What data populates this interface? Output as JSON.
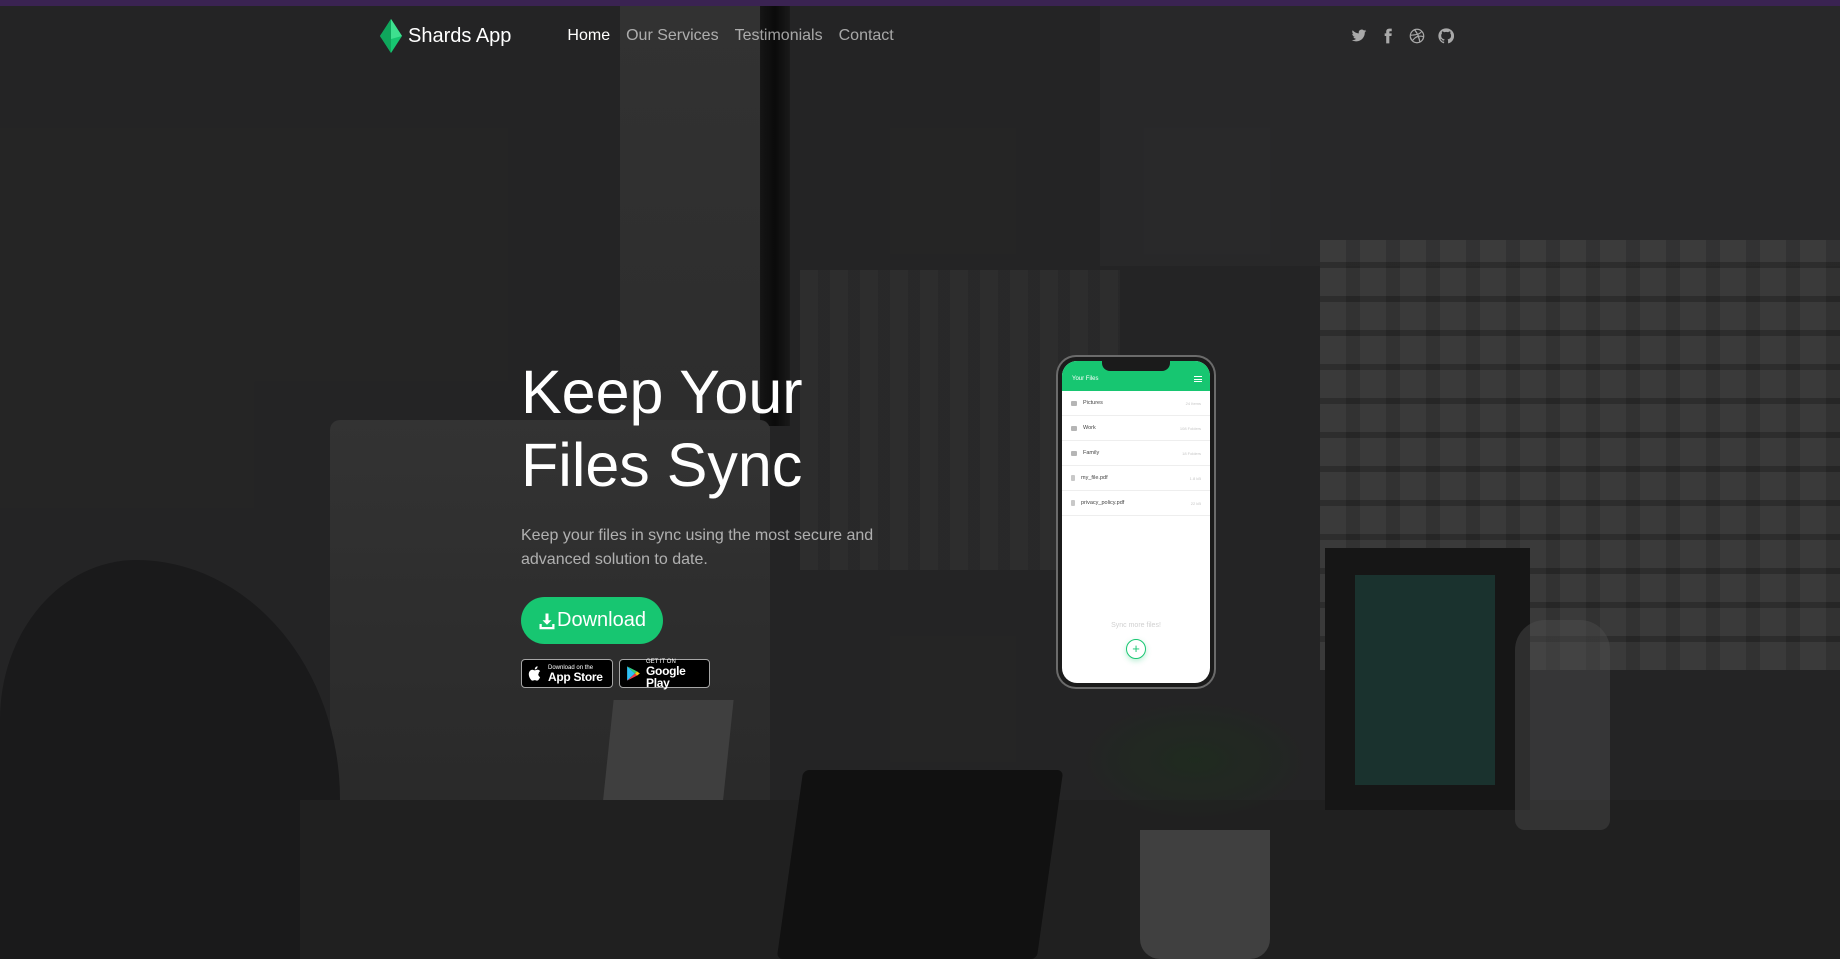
{
  "brand": {
    "name": "Shards App",
    "accent_color": "#17c671"
  },
  "nav": {
    "links": [
      {
        "label": "Home",
        "active": true
      },
      {
        "label": "Our Services",
        "active": false
      },
      {
        "label": "Testimonials",
        "active": false
      },
      {
        "label": "Contact",
        "active": false
      }
    ],
    "socials": [
      "twitter-icon",
      "facebook-icon",
      "dribbble-icon",
      "github-icon"
    ]
  },
  "hero": {
    "title_line1": "Keep Your",
    "title_line2": "Files Sync",
    "subtitle": "Keep your files in sync using the most secure and advanced solution to date.",
    "download_label": "Download",
    "app_store": {
      "small": "Download on the",
      "big": "App Store"
    },
    "google_play": {
      "small": "GET IT ON",
      "big": "Google Play"
    }
  },
  "phone": {
    "header_title": "Your Files",
    "files": [
      {
        "name": "Pictures",
        "meta": "24 Items",
        "type": "folder"
      },
      {
        "name": "Work",
        "meta": "108 Folders",
        "type": "folder"
      },
      {
        "name": "Family",
        "meta": "18 Folders",
        "type": "folder"
      },
      {
        "name": "my_file.pdf",
        "meta": "1.8 kB",
        "type": "file"
      },
      {
        "name": "privacy_policy.pdf",
        "meta": "22 kB",
        "type": "file"
      }
    ],
    "sync_text": "Sync more files!",
    "add_symbol": "+"
  }
}
